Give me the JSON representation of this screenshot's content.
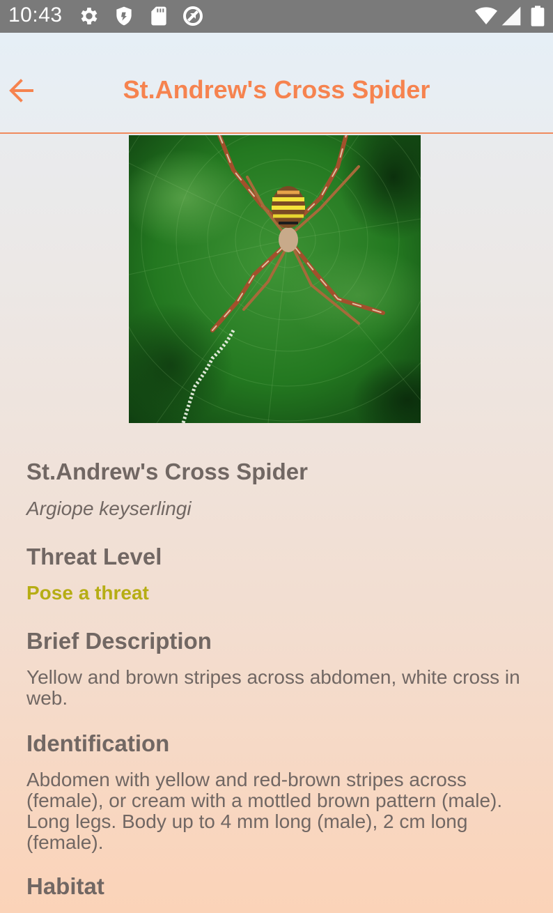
{
  "status_bar": {
    "time": "10:43",
    "icons": [
      "gear-icon",
      "shield-icon",
      "sd-card-icon",
      "sync-icon",
      "wifi-icon",
      "signal-icon",
      "battery-icon"
    ]
  },
  "toolbar": {
    "back_icon": "arrow-left-icon",
    "title": "St.Andrew's Cross Spider",
    "accent_color": "#f6834f"
  },
  "spider": {
    "common_name": "St.Andrew's Cross Spider",
    "scientific_name": "Argiope keyserlingi",
    "threat_heading": "Threat Level",
    "threat_value": "Pose a threat",
    "threat_color": "#b6ad14",
    "brief_heading": "Brief Description",
    "brief_text": "Yellow and brown stripes across abdomen, white cross in web.",
    "identification_heading": "Identification",
    "identification_text": "Abdomen with yellow and red-brown stripes across (female), or cream with a mottled brown pattern (male). Long legs. Body up to 4 mm long (male), 2 cm long (female).",
    "habitat_heading": "Habitat"
  }
}
